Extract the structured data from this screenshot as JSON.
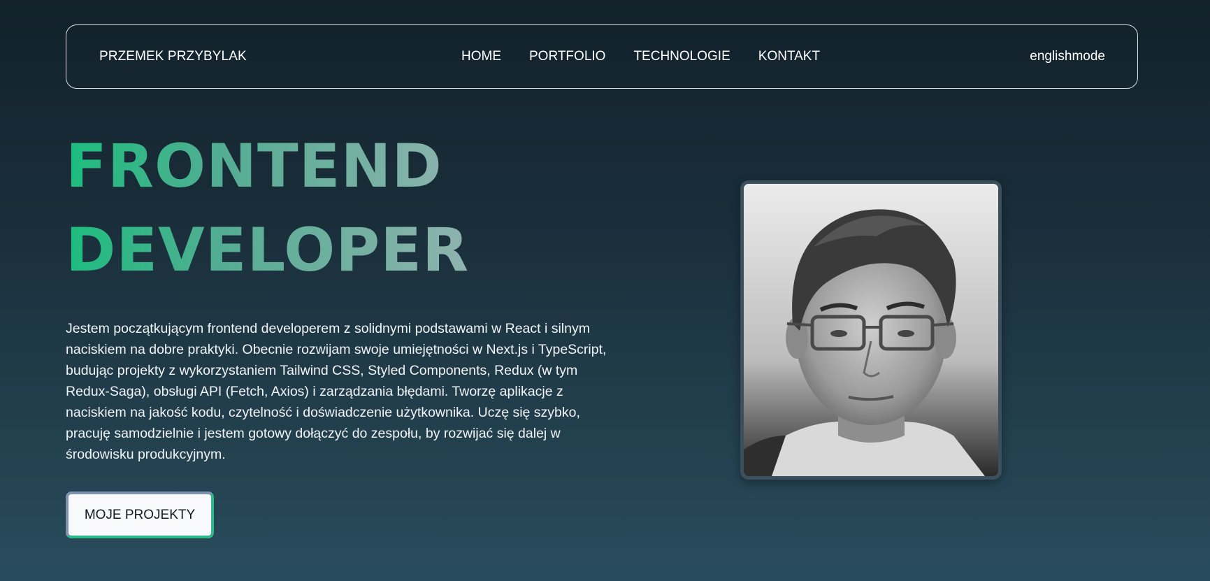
{
  "nav": {
    "brand": "PRZEMEK PRZYBYLAK",
    "links": [
      "HOME",
      "PORTFOLIO",
      "TECHNOLOGIE",
      "KONTAKT"
    ],
    "lang_toggle": "englishmode"
  },
  "hero": {
    "title_line1": "FRONTEND",
    "title_line2": "DEVELOPER",
    "description": "Jestem początkującym frontend developerem z solidnymi podstawami w React i silnym naciskiem na dobre praktyki. Obecnie rozwijam swoje umiejętności w Next.js i TypeScript, budując projekty z wykorzystaniem Tailwind CSS, Styled Components, Redux (w tym Redux-Saga), obsługi API (Fetch, Axios) i zarządzania błędami. Tworzę aplikacje z naciskiem na jakość kodu, czytelność i doświadczenie użytkownika. Uczę się szybko, pracuję samodzielnie i jestem gotowy dołączyć do zespołu, by rozwijać się dalej w środowisku produkcyjnym.",
    "cta_label": "MOJE PROJEKTY"
  },
  "colors": {
    "accent_green": "#1cbd7e",
    "accent_grey": "#8fb3af",
    "bg_top": "#12212a",
    "bg_bottom": "#294c5c"
  }
}
